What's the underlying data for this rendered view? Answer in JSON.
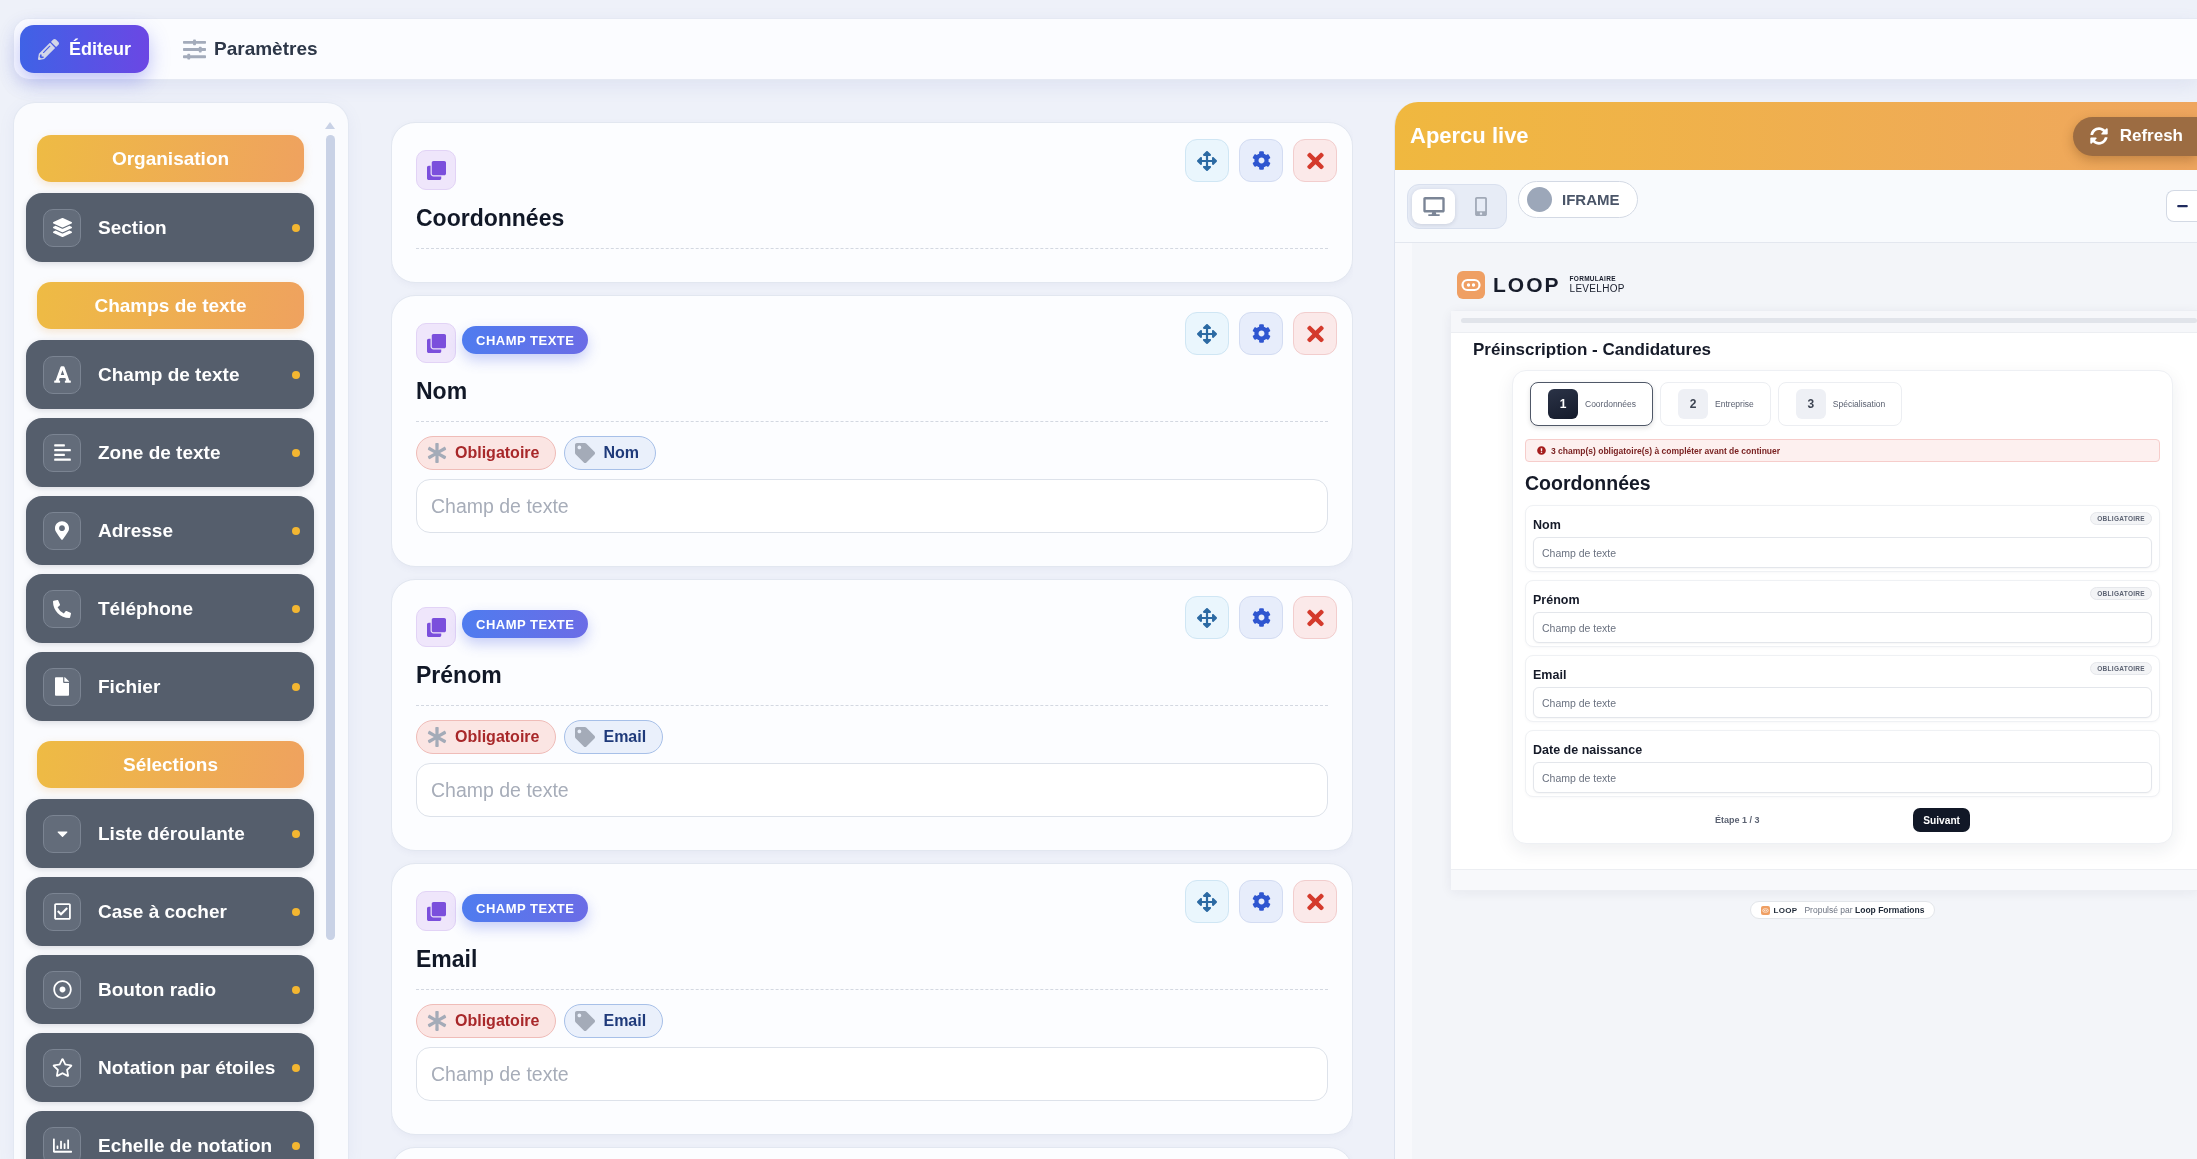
{
  "toolbar": {
    "tabs": [
      {
        "label": "Éditeur",
        "kind": "editor",
        "selected": true
      },
      {
        "label": "Paramètres",
        "kind": "settings",
        "selected": false
      }
    ]
  },
  "sidebar": {
    "groups": [
      {
        "title": "Organisation",
        "items": [
          {
            "label": "Section",
            "kind": "section"
          }
        ]
      },
      {
        "title": "Champs de texte",
        "items": [
          {
            "label": "Champ de texte",
            "kind": "text"
          },
          {
            "label": "Zone de texte",
            "kind": "textarea"
          },
          {
            "label": "Adresse",
            "kind": "address"
          },
          {
            "label": "Téléphone",
            "kind": "phone"
          },
          {
            "label": "Fichier",
            "kind": "file"
          }
        ]
      },
      {
        "title": "Sélections",
        "items": [
          {
            "label": "Liste déroulante",
            "kind": "dropdown"
          },
          {
            "label": "Case à cocher",
            "kind": "checkbox"
          },
          {
            "label": "Bouton radio",
            "kind": "radio"
          },
          {
            "label": "Notation par étoiles",
            "kind": "rating"
          },
          {
            "label": "Echelle de notation",
            "kind": "scale"
          }
        ]
      }
    ]
  },
  "canvas": {
    "cards": [
      {
        "kind": "section",
        "title": "Coordonnées"
      },
      {
        "kind": "field",
        "badge": "CHAMP TEXTE",
        "title": "Nom",
        "tags": [
          {
            "kind": "required",
            "label": "Obligatoire"
          },
          {
            "kind": "mapping",
            "label": "Nom"
          }
        ],
        "placeholder": "Champ de texte"
      },
      {
        "kind": "field",
        "badge": "CHAMP TEXTE",
        "title": "Prénom",
        "tags": [
          {
            "kind": "required",
            "label": "Obligatoire"
          },
          {
            "kind": "mapping",
            "label": "Email"
          }
        ],
        "placeholder": "Champ de texte"
      },
      {
        "kind": "field",
        "badge": "CHAMP TEXTE",
        "title": "Email",
        "tags": [
          {
            "kind": "required",
            "label": "Obligatoire"
          },
          {
            "kind": "mapping",
            "label": "Email"
          }
        ],
        "placeholder": "Champ de texte"
      },
      {
        "kind": "field"
      }
    ]
  },
  "preview": {
    "title": "Apercu live",
    "refresh": "Refresh",
    "view_modes": [
      {
        "kind": "desktop",
        "selected": true
      },
      {
        "kind": "mobile",
        "selected": false
      }
    ],
    "iframe": {
      "label": "IFRAME",
      "on": false
    },
    "form": {
      "brand": "LOOP",
      "brand_caption": "FORMULAIRE",
      "brand_org": "LEVELHOP",
      "title": "Préinscription - Candidatures",
      "steps": [
        {
          "number": "1",
          "label": "Coordonnées",
          "selected": true
        },
        {
          "number": "2",
          "label": "Entreprise",
          "selected": false
        },
        {
          "number": "3",
          "label": "Spécialisation",
          "selected": false
        }
      ],
      "alert": "3 champ(s) obligatoire(s) à compléter avant de continuer",
      "section_title": "Coordonnées",
      "fields": [
        {
          "label": "Nom",
          "badge": "OBLIGATOIRE",
          "placeholder": "Champ de texte"
        },
        {
          "label": "Prénom",
          "badge": "OBLIGATOIRE",
          "placeholder": "Champ de texte"
        },
        {
          "label": "Email",
          "badge": "OBLIGATOIRE",
          "placeholder": "Champ de texte"
        },
        {
          "label": "Date de naissance",
          "placeholder": "Champ de texte"
        }
      ],
      "step_counter": "Étape 1 / 3",
      "next_button": "Suivant"
    },
    "footer": {
      "brand": "LOOP",
      "text": "Propulsé par **Loop Formations**"
    }
  }
}
